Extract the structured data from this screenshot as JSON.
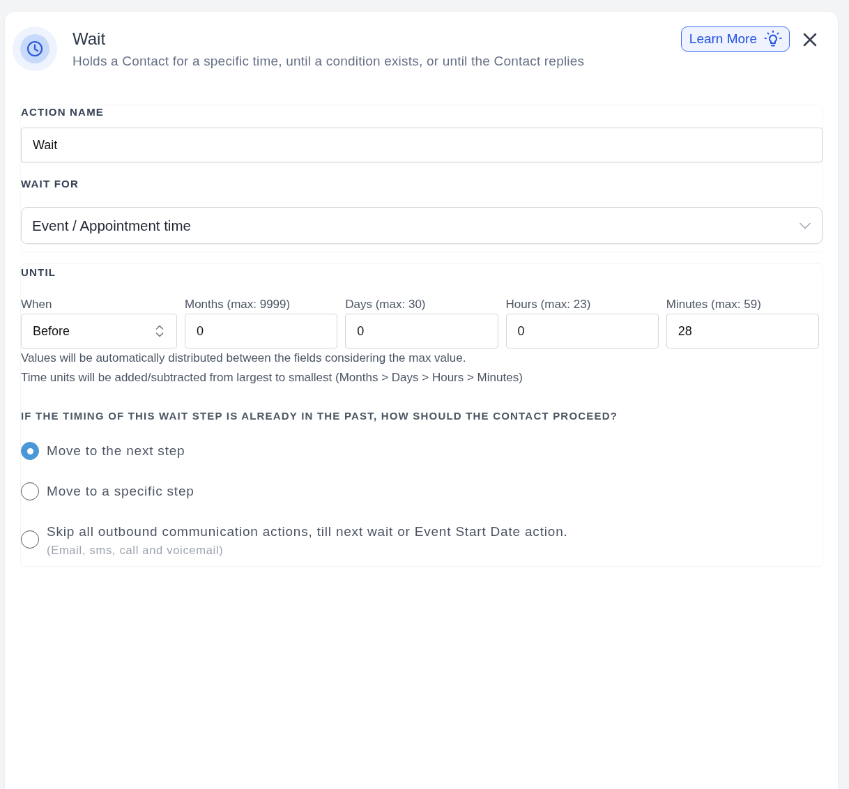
{
  "panel": {
    "title": "Wait",
    "subtitle": "Holds a Contact for a specific time, until a condition exists, or until the Contact replies",
    "learn_more": "Learn More"
  },
  "action_name": {
    "label": "ACTION NAME",
    "value": "Wait"
  },
  "wait_for": {
    "label": "WAIT FOR",
    "value": "Event / Appointment time"
  },
  "until": {
    "label": "UNTIL",
    "fields": [
      {
        "kind": "select",
        "label": "When",
        "value": "Before"
      },
      {
        "kind": "number",
        "label": "Months (max: 9999)",
        "value": "0"
      },
      {
        "kind": "number",
        "label": "Days (max: 30)",
        "value": "0"
      },
      {
        "kind": "number",
        "label": "Hours (max: 23)",
        "value": "0"
      },
      {
        "kind": "number",
        "label": "Minutes (max: 59)",
        "value": "28"
      }
    ],
    "hints": [
      "Values will be automatically distributed between the fields considering the max value.",
      "Time units will be added/subtracted from largest to smallest (Months > Days > Hours > Minutes)"
    ]
  },
  "past_behavior": {
    "question": "IF THE TIMING OF THIS WAIT STEP IS ALREADY IN THE PAST, HOW SHOULD THE CONTACT PROCEED?",
    "options": [
      {
        "label": "Move to the next step",
        "selected": true
      },
      {
        "label": "Move to a specific step",
        "selected": false
      },
      {
        "label": "Skip all outbound communication actions, till next wait or Event Start Date action.",
        "note": "(Email, sms, call and voicemail)",
        "selected": false
      }
    ]
  }
}
